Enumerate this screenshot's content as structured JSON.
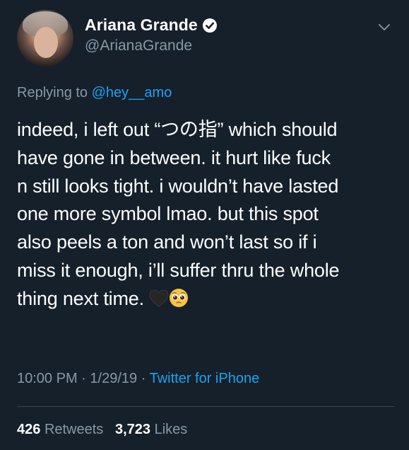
{
  "tweet": {
    "display_name": "Ariana Grande",
    "handle": "@ArianaGrande",
    "replying_prefix": "Replying to",
    "replying_to": "@hey__amo",
    "body_lines": [
      "indeed, i left out “つの指” which should",
      "have gone in between. it hurt like fuck",
      "n still looks tight. i wouldn’t have lasted",
      "one more symbol lmao. but this spot",
      "also peels a ton and won’t last so if i",
      "miss it enough, i’ll suffer thru the whole",
      "thing next time."
    ],
    "emojis": [
      "black-heart-emoji",
      "pleading-face-emoji"
    ],
    "time": "10:00 PM",
    "date": "1/29/19",
    "separator": "·",
    "source": "Twitter for iPhone",
    "retweets_count": "426",
    "retweets_label": "Retweets",
    "likes_count": "3,723",
    "likes_label": "Likes"
  },
  "colors": {
    "background": "#15202b",
    "text": "#ffffff",
    "secondary_text": "#8899a6",
    "accent": "#1da1f2",
    "divider": "#38444d"
  }
}
